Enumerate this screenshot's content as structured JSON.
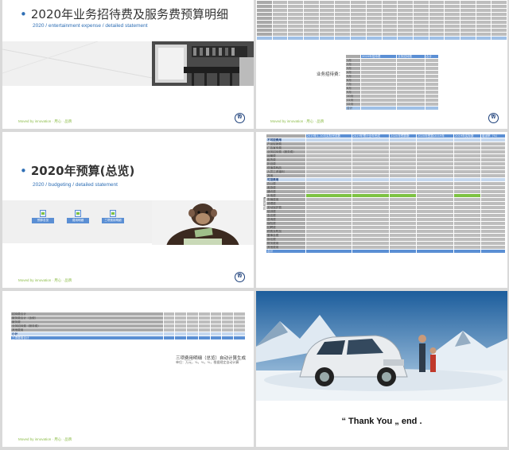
{
  "slide1": {
    "title": "2020年业务招待费及服务费预算明细",
    "subtitle": "2020 / entertainment expense / detailed statement",
    "footer": "Moved by innovation · 用心 · 品牌"
  },
  "slide2": {
    "side_label": "业务招待费：",
    "col_headers": [
      "2020年招待费",
      "业务招待费",
      "合计"
    ],
    "row_labels": [
      "1月",
      "2月",
      "3月",
      "4月",
      "5月",
      "6月",
      "7月",
      "8月",
      "9月",
      "10月",
      "11月",
      "12月"
    ],
    "total_label": "合计",
    "footer": "Moved by innovation · 用心 · 品牌"
  },
  "slide3": {
    "title": "2020年预算(总览)",
    "subtitle": "2020 / budgeting / detailed statement",
    "buttons": [
      "预算总览",
      "费用明细",
      "三项费用明细"
    ],
    "footer": "Moved by innovation · 用心 · 品牌"
  },
  "slide4": {
    "side_label": "费用项目",
    "col_headers": [
      "2019年1-10月实际完成数",
      "2019年预计全年完成",
      "2020年预算数",
      "2020年预算/2019年",
      "2019年实际数",
      "增减率（%）"
    ],
    "sections": [
      {
        "label": "不可控费用",
        "rows": [
          "产品促销费",
          "广告宣传费",
          "业务招待费（服务费）",
          "运输费",
          "租赁费",
          "折旧费",
          "低值易耗品",
          "人员工资福利",
          "其他"
        ]
      },
      {
        "label": "可控费用",
        "rows": [
          "办公费",
          "差旅费",
          "通讯费",
          "水电费",
          "车辆费用",
          "修理费",
          "劳动保护费",
          "培训费",
          "会议费",
          "咨询费",
          "保险费",
          "招聘费",
          "税费及附加",
          "董事会费",
          "诉讼费",
          "财务费用",
          "其他费用"
        ]
      }
    ],
    "total_label": "合计"
  },
  "slide5": {
    "rows": [
      "招待费合计",
      "服务费合计（含税）",
      "服务费",
      "业务招待费（服务费）",
      "其他费用"
    ],
    "subtotal_label": "小计",
    "total_label": "三项费用合计",
    "note_title": "三项费用明细（总览）自动计算生成",
    "note_sub": "单位：万元，%，%，%，根据规定自动计算",
    "footer": "Moved by innovation · 用心 · 品牌"
  },
  "slide6": {
    "thanks": "“ Thank You „ end ."
  },
  "colors": {
    "accent_blue": "#2f6fb5",
    "header_blue": "#5b8fd4",
    "footer_green": "#8dbd4a",
    "highlight_green": "#7dc242",
    "cell_gray": "#bdbdbd"
  }
}
